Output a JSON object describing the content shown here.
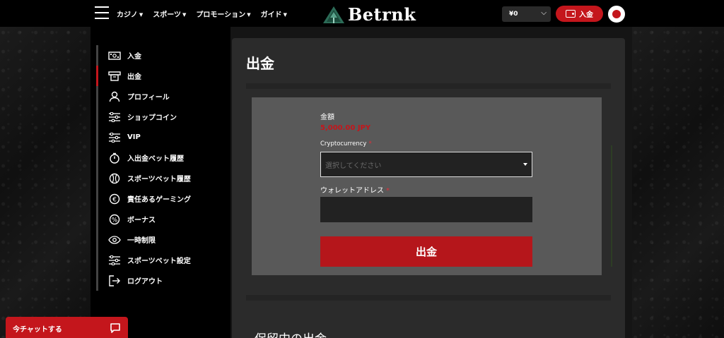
{
  "header": {
    "nav": [
      {
        "label": "カジノ"
      },
      {
        "label": "スポーツ"
      },
      {
        "label": "プロモーション"
      },
      {
        "label": "ガイド"
      }
    ],
    "logo_text": "Betrnk",
    "balance": "¥0",
    "deposit_label": "入金"
  },
  "sidebar": {
    "items": [
      {
        "label": "入金",
        "icon": "cash-icon"
      },
      {
        "label": "出金",
        "icon": "atm-icon"
      },
      {
        "label": "プロフィール",
        "icon": "user-icon"
      },
      {
        "label": "ショップコイン",
        "icon": "sliders-icon"
      },
      {
        "label": "VIP",
        "icon": "sliders-icon"
      },
      {
        "label": "入出金ベット履歴",
        "icon": "timer-icon"
      },
      {
        "label": "スポーツベット履歴",
        "icon": "ball-icon"
      },
      {
        "label": "責任あるゲーミング",
        "icon": "euro-coin-icon"
      },
      {
        "label": "ボーナス",
        "icon": "percent-icon"
      },
      {
        "label": "一時制限",
        "icon": "eye-icon"
      },
      {
        "label": "スポーツベット設定",
        "icon": "sliders-icon"
      },
      {
        "label": "ログアウト",
        "icon": "logout-icon"
      }
    ],
    "active_index": 1
  },
  "chat": {
    "label": "今チャットする"
  },
  "main": {
    "title": "出金",
    "amount_label": "金額",
    "amount_value": "5,000.00 JPY",
    "crypto_label": "Cryptocurrency",
    "crypto_placeholder": "選択してください",
    "wallet_label": "ウォレットアドレス",
    "required_mark": "*",
    "withdraw_button": "出金",
    "pending_title": "保留中の出金"
  },
  "colors": {
    "accent": "#c4161c",
    "panel": "#2b2b2b",
    "form_box": "#595959"
  }
}
